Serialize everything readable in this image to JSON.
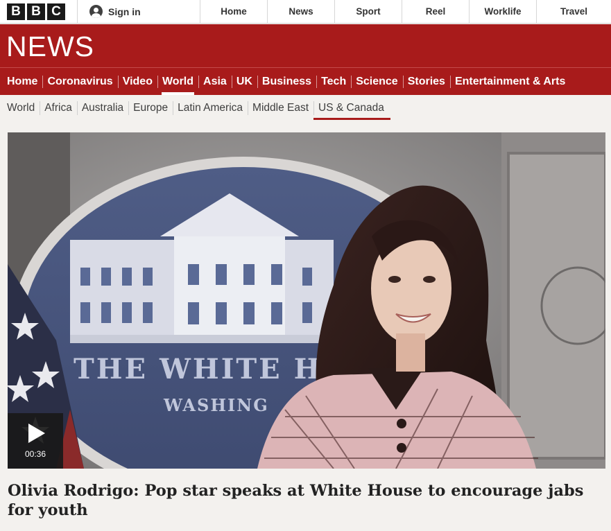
{
  "brand": {
    "logo_letters": [
      "B",
      "B",
      "C"
    ],
    "section_title": "NEWS"
  },
  "account": {
    "signin_label": "Sign in",
    "icon": "user-icon"
  },
  "top_nav": [
    "Home",
    "News",
    "Sport",
    "Reel",
    "Worklife",
    "Travel"
  ],
  "main_nav": {
    "items": [
      "Home",
      "Coronavirus",
      "Video",
      "World",
      "Asia",
      "UK",
      "Business",
      "Tech",
      "Science",
      "Stories",
      "Entertainment & Arts"
    ],
    "active": "World"
  },
  "sub_nav": {
    "items": [
      "World",
      "Africa",
      "Australia",
      "Europe",
      "Latin America",
      "Middle East",
      "US & Canada"
    ],
    "active": "US & Canada"
  },
  "video": {
    "duration": "00:36",
    "backdrop_text_line1": "THE WHITE H",
    "backdrop_text_line2": "WASHING"
  },
  "headline": "Olivia Rodrigo: Pop star speaks at White House to encourage jabs for youth",
  "colors": {
    "brand_red": "#a81b1b",
    "text_dark": "#222222",
    "page_bg": "#f3f1ee"
  }
}
